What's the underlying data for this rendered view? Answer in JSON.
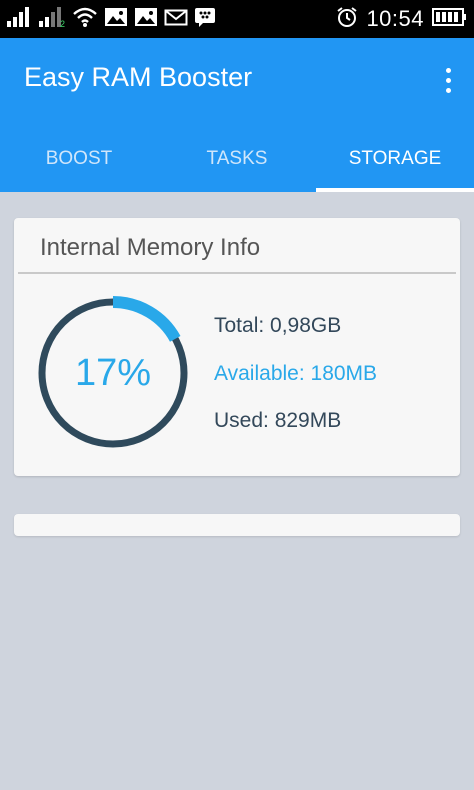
{
  "status_bar": {
    "time": "10:54",
    "left_icons": [
      "signal-icon",
      "signal-icon-2",
      "wifi-icon",
      "image-icon",
      "image-icon",
      "email-icon",
      "chat-icon"
    ],
    "right_icons": [
      "alarm-icon",
      "battery-icon"
    ]
  },
  "app": {
    "title": "Easy RAM Booster",
    "tabs": [
      {
        "label": "BOOST"
      },
      {
        "label": "TASKS"
      },
      {
        "label": "STORAGE"
      }
    ],
    "active_tab": "STORAGE"
  },
  "memory_card": {
    "title": "Internal Memory Info",
    "percent_label": "17%",
    "percent_value": 17,
    "total": "Total: 0,98GB",
    "available": "Available: 180MB",
    "used": "Used: 829MB"
  },
  "colors": {
    "app_bar": "#2196f3",
    "accent": "#29a8e9",
    "ring_track": "#2f4a5c"
  }
}
